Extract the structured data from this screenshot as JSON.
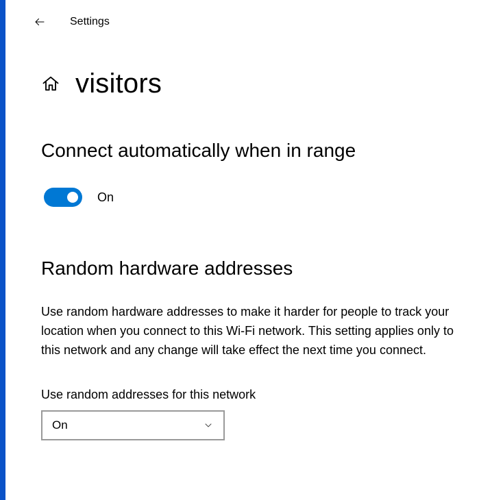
{
  "header": {
    "app_title": "Settings"
  },
  "page": {
    "title": "visitors"
  },
  "section_connect": {
    "heading": "Connect automatically when in range",
    "toggle_state": "On"
  },
  "section_random": {
    "heading": "Random hardware addresses",
    "description": "Use random hardware addresses to make it harder for people to track your location when you connect to this Wi-Fi network. This setting applies only to this network and any change will take effect the next time you connect.",
    "field_label": "Use random addresses for this network",
    "dropdown_value": "On"
  }
}
